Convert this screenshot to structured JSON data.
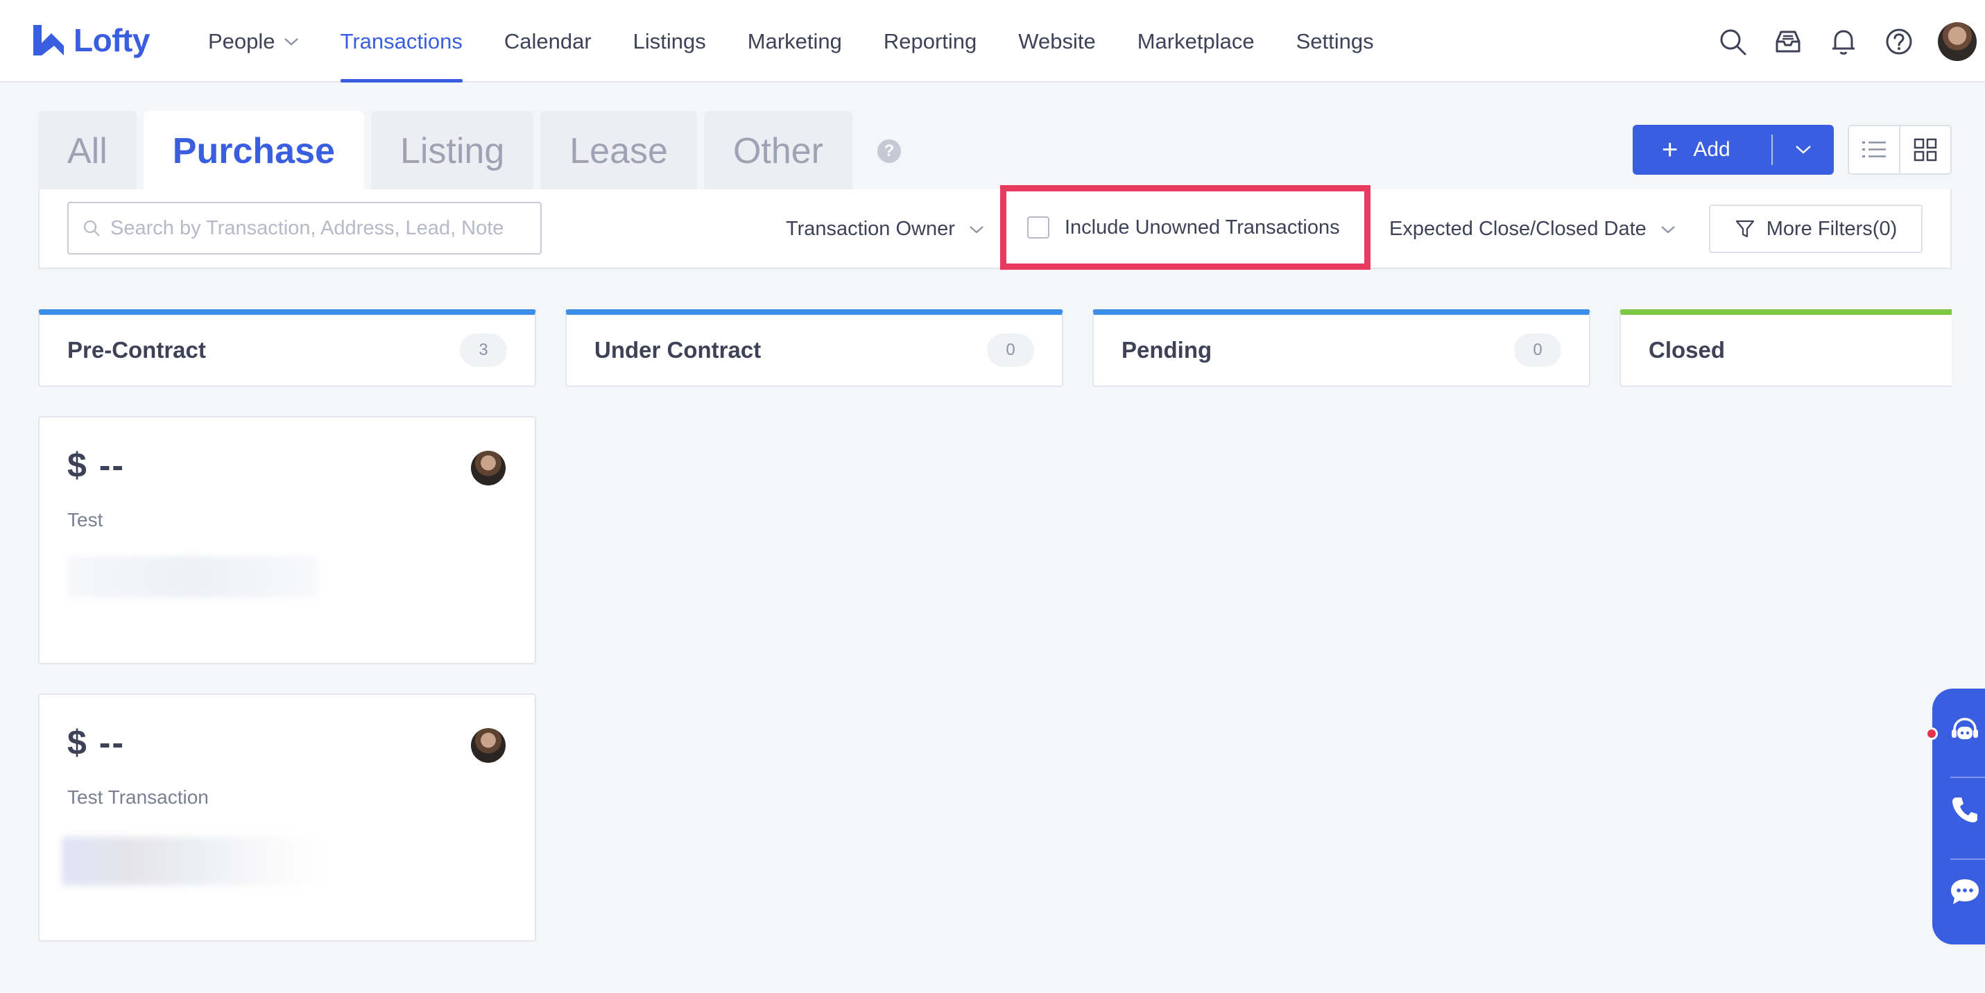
{
  "app": {
    "brand": "Lofty",
    "accent": "#3a5ee0",
    "highlight": "#e63a5e"
  },
  "nav": {
    "items": [
      {
        "label": "People",
        "has_dropdown": true,
        "active": false
      },
      {
        "label": "Transactions",
        "active": true
      },
      {
        "label": "Calendar",
        "active": false
      },
      {
        "label": "Listings",
        "active": false
      },
      {
        "label": "Marketing",
        "active": false
      },
      {
        "label": "Reporting",
        "active": false
      },
      {
        "label": "Website",
        "active": false
      },
      {
        "label": "Marketplace",
        "active": false
      },
      {
        "label": "Settings",
        "active": false
      }
    ],
    "icons": [
      "search-icon",
      "inbox-icon",
      "bell-icon",
      "help-icon",
      "avatar"
    ]
  },
  "tabs": {
    "items": [
      {
        "label": "All",
        "active": false
      },
      {
        "label": "Purchase",
        "active": true
      },
      {
        "label": "Listing",
        "active": false
      },
      {
        "label": "Lease",
        "active": false
      },
      {
        "label": "Other",
        "active": false
      }
    ],
    "help": "?"
  },
  "toolbar": {
    "add_label": "Add",
    "view_modes": [
      "list",
      "grid"
    ],
    "selected_view": "grid"
  },
  "filters": {
    "search_placeholder": "Search by Transaction, Address, Lead, Note",
    "search_value": "",
    "owner_label": "Transaction Owner",
    "unowned_label": "Include Unowned Transactions",
    "unowned_checked": false,
    "date_label": "Expected Close/Closed Date",
    "more_filters_label": "More Filters(0)"
  },
  "columns": [
    {
      "title": "Pre-Contract",
      "count": "3",
      "color": "#3c8ee8"
    },
    {
      "title": "Under Contract",
      "count": "0",
      "color": "#3c8ee8"
    },
    {
      "title": "Pending",
      "count": "0",
      "color": "#3c8ee8"
    },
    {
      "title": "Closed",
      "count": "",
      "color": "#7dc742"
    }
  ],
  "cards": [
    {
      "price": "$ --",
      "name": "Test"
    },
    {
      "price": "$ --",
      "name": "Test Transaction"
    }
  ],
  "side_widget": {
    "icons": [
      "support-agent-icon",
      "phone-icon",
      "chat-icon"
    ]
  }
}
